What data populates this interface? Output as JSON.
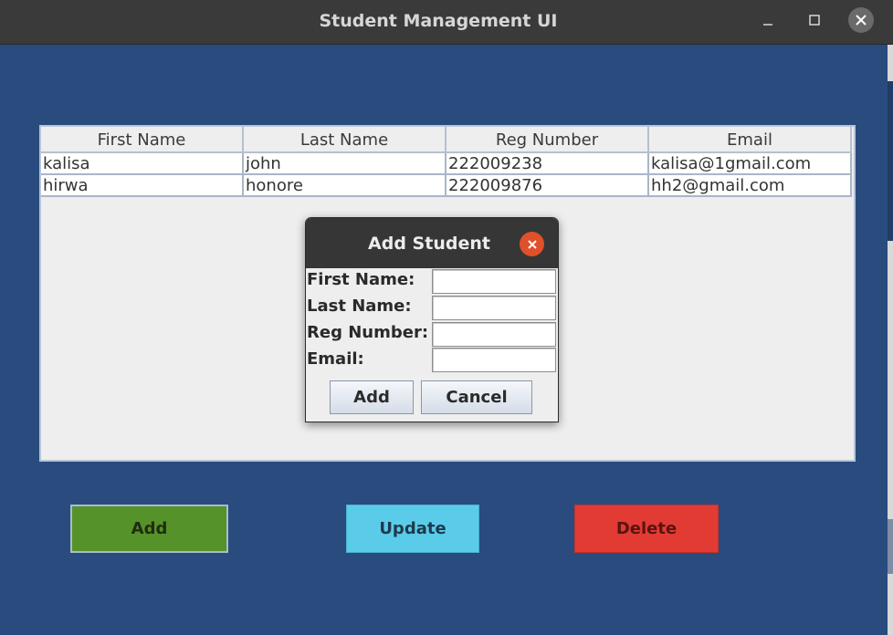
{
  "window": {
    "title": "Student Management UI"
  },
  "table": {
    "columns": [
      "First Name",
      "Last Name",
      "Reg Number",
      "Email"
    ],
    "rows": [
      [
        "kalisa",
        "john",
        "222009238",
        "kalisa@1gmail.com"
      ],
      [
        "hirwa",
        "honore",
        "222009876",
        "hh2@gmail.com"
      ]
    ]
  },
  "buttons": {
    "add": "Add",
    "update": "Update",
    "delete": "Delete"
  },
  "dialog": {
    "title": "Add Student",
    "fields": [
      {
        "label": "First Name:",
        "value": ""
      },
      {
        "label": "Last Name:",
        "value": ""
      },
      {
        "label": "Reg Number:",
        "value": ""
      },
      {
        "label": "Email:",
        "value": ""
      }
    ],
    "add_label": "Add",
    "cancel_label": "Cancel"
  },
  "colors": {
    "background": "#294b7e",
    "add_button": "#56922a",
    "update_button": "#5bcbea",
    "delete_button": "#e23b33",
    "dialog_close": "#e0502a"
  },
  "icons": {
    "minimize": "minimize-icon",
    "maximize": "maximize-icon",
    "close": "close-icon"
  }
}
